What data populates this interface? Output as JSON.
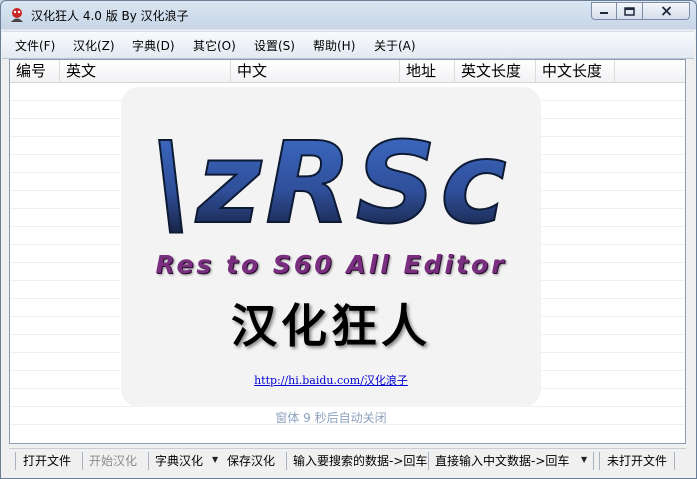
{
  "window": {
    "title": "汉化狂人 4.0 版 By 汉化浪子"
  },
  "menu": [
    "文件(F)",
    "汉化(Z)",
    "字典(D)",
    "其它(O)",
    "设置(S)",
    "帮助(H)",
    "关于(A)"
  ],
  "table": {
    "columns": [
      "编号",
      "英文",
      "中文",
      "地址",
      "英文长度",
      "中文长度"
    ]
  },
  "splash": {
    "logo_text": "\\zRSc",
    "tagline": "Res to S60 All Editor",
    "cn_title": "汉化狂人",
    "link": "http://hi.baidu.com/汉化浪子",
    "countdown": "窗体 9 秒后自动关闭"
  },
  "statusbar": {
    "open_file": "打开文件",
    "start_translate": "开始汉化",
    "dict_translate": "字典汉化",
    "save_translate": "保存汉化",
    "search_input": "输入要搜索的数据->回车",
    "chinese_input": "直接输入中文数据->回车",
    "file_status": "未打开文件"
  },
  "icons": {
    "app": "app-icon",
    "minimize": "minimize-icon",
    "maximize": "maximize-icon",
    "close": "close-icon",
    "dropdown": "chevron-down-icon"
  },
  "colors": {
    "logo_blue": "#3a5fb0",
    "tagline_purple": "#7a2e80",
    "link_blue": "#0000d0"
  }
}
